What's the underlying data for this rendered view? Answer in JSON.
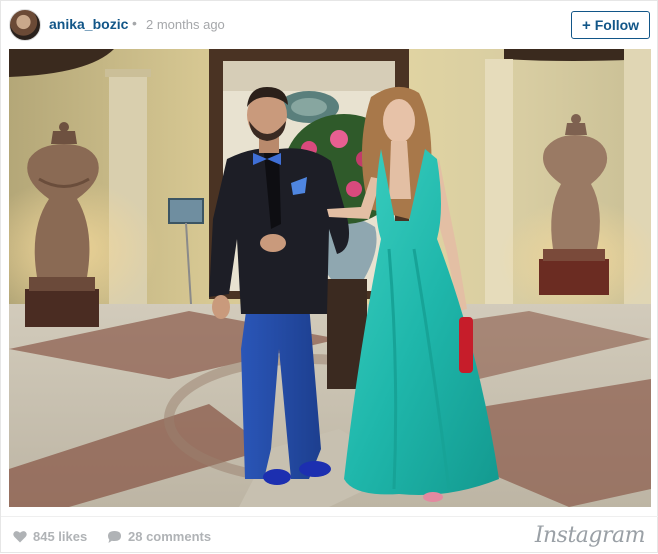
{
  "post": {
    "author": {
      "username": "anika_bozic",
      "avatar": "avatar-photo"
    },
    "separator": "•",
    "time_ago": "2 months ago",
    "follow": {
      "label": "Follow",
      "icon": "plus-icon"
    },
    "photo": {
      "subject": "couple-in-formal-wear-hotel-lobby"
    },
    "likes": {
      "label": "845 likes",
      "icon": "heart-icon"
    },
    "comments": {
      "label": "28 comments",
      "icon": "comment-bubble-icon"
    },
    "brand": "Instagram"
  },
  "colors": {
    "link": "#125688",
    "muted": "#a5a7aa",
    "dress": "#1fb7ab"
  }
}
